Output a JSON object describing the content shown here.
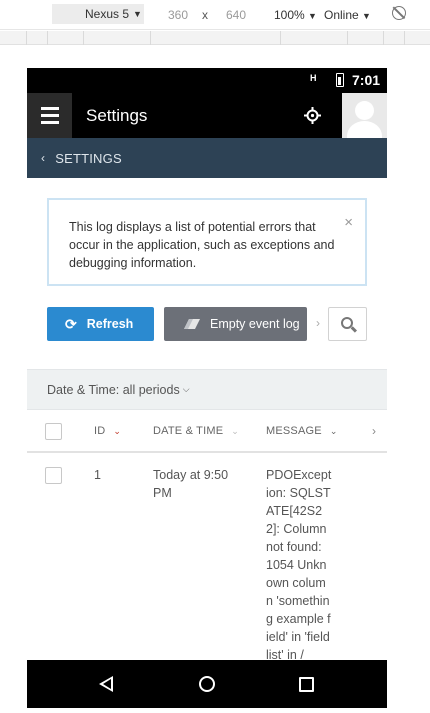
{
  "devtools": {
    "device": "Nexus 5",
    "width": "360",
    "times": "x",
    "height": "640",
    "zoom": "100%",
    "network": "Online",
    "arrow": "▼"
  },
  "status_bar": {
    "signal": "H",
    "time": "7:01"
  },
  "header": {
    "title": "Settings",
    "icons": [
      "menu-icon",
      "locate-icon",
      "avatar"
    ]
  },
  "breadcrumb": {
    "chevron": "‹",
    "label": "SETTINGS"
  },
  "notice": {
    "text": "This log displays a list of potential errors that occur in the application, such as exceptions and debugging information.",
    "close": "×"
  },
  "actions": {
    "refresh_label": "Refresh",
    "refresh_icon": "⟳",
    "empty_label": "Empty event log",
    "empty_icon": "eraser-icon",
    "more": "›"
  },
  "filter": {
    "label": "Date & Time: all periods",
    "caret": "⌵"
  },
  "table": {
    "columns": [
      {
        "label": "ID",
        "sort_icon": "⌄"
      },
      {
        "label": "DATE & TIME",
        "sort_icon": "⌄"
      },
      {
        "label": "MESSAGE",
        "sort_icon": "⌄"
      }
    ],
    "more": "›",
    "rows": [
      {
        "id": "1",
        "date": "Today at 9:50 PM",
        "message": "PDOException: SQLSTATE[42S22]: Column not found: 1054 Unknown column 'something example field' in 'field list' in /"
      }
    ]
  },
  "colors": {
    "breadcrumb_bg": "#2d4255",
    "refresh_bg": "#2b8ad0",
    "empty_bg": "#6c7078",
    "notice_border": "#cce3f3",
    "filter_bg": "#eef1f2"
  }
}
